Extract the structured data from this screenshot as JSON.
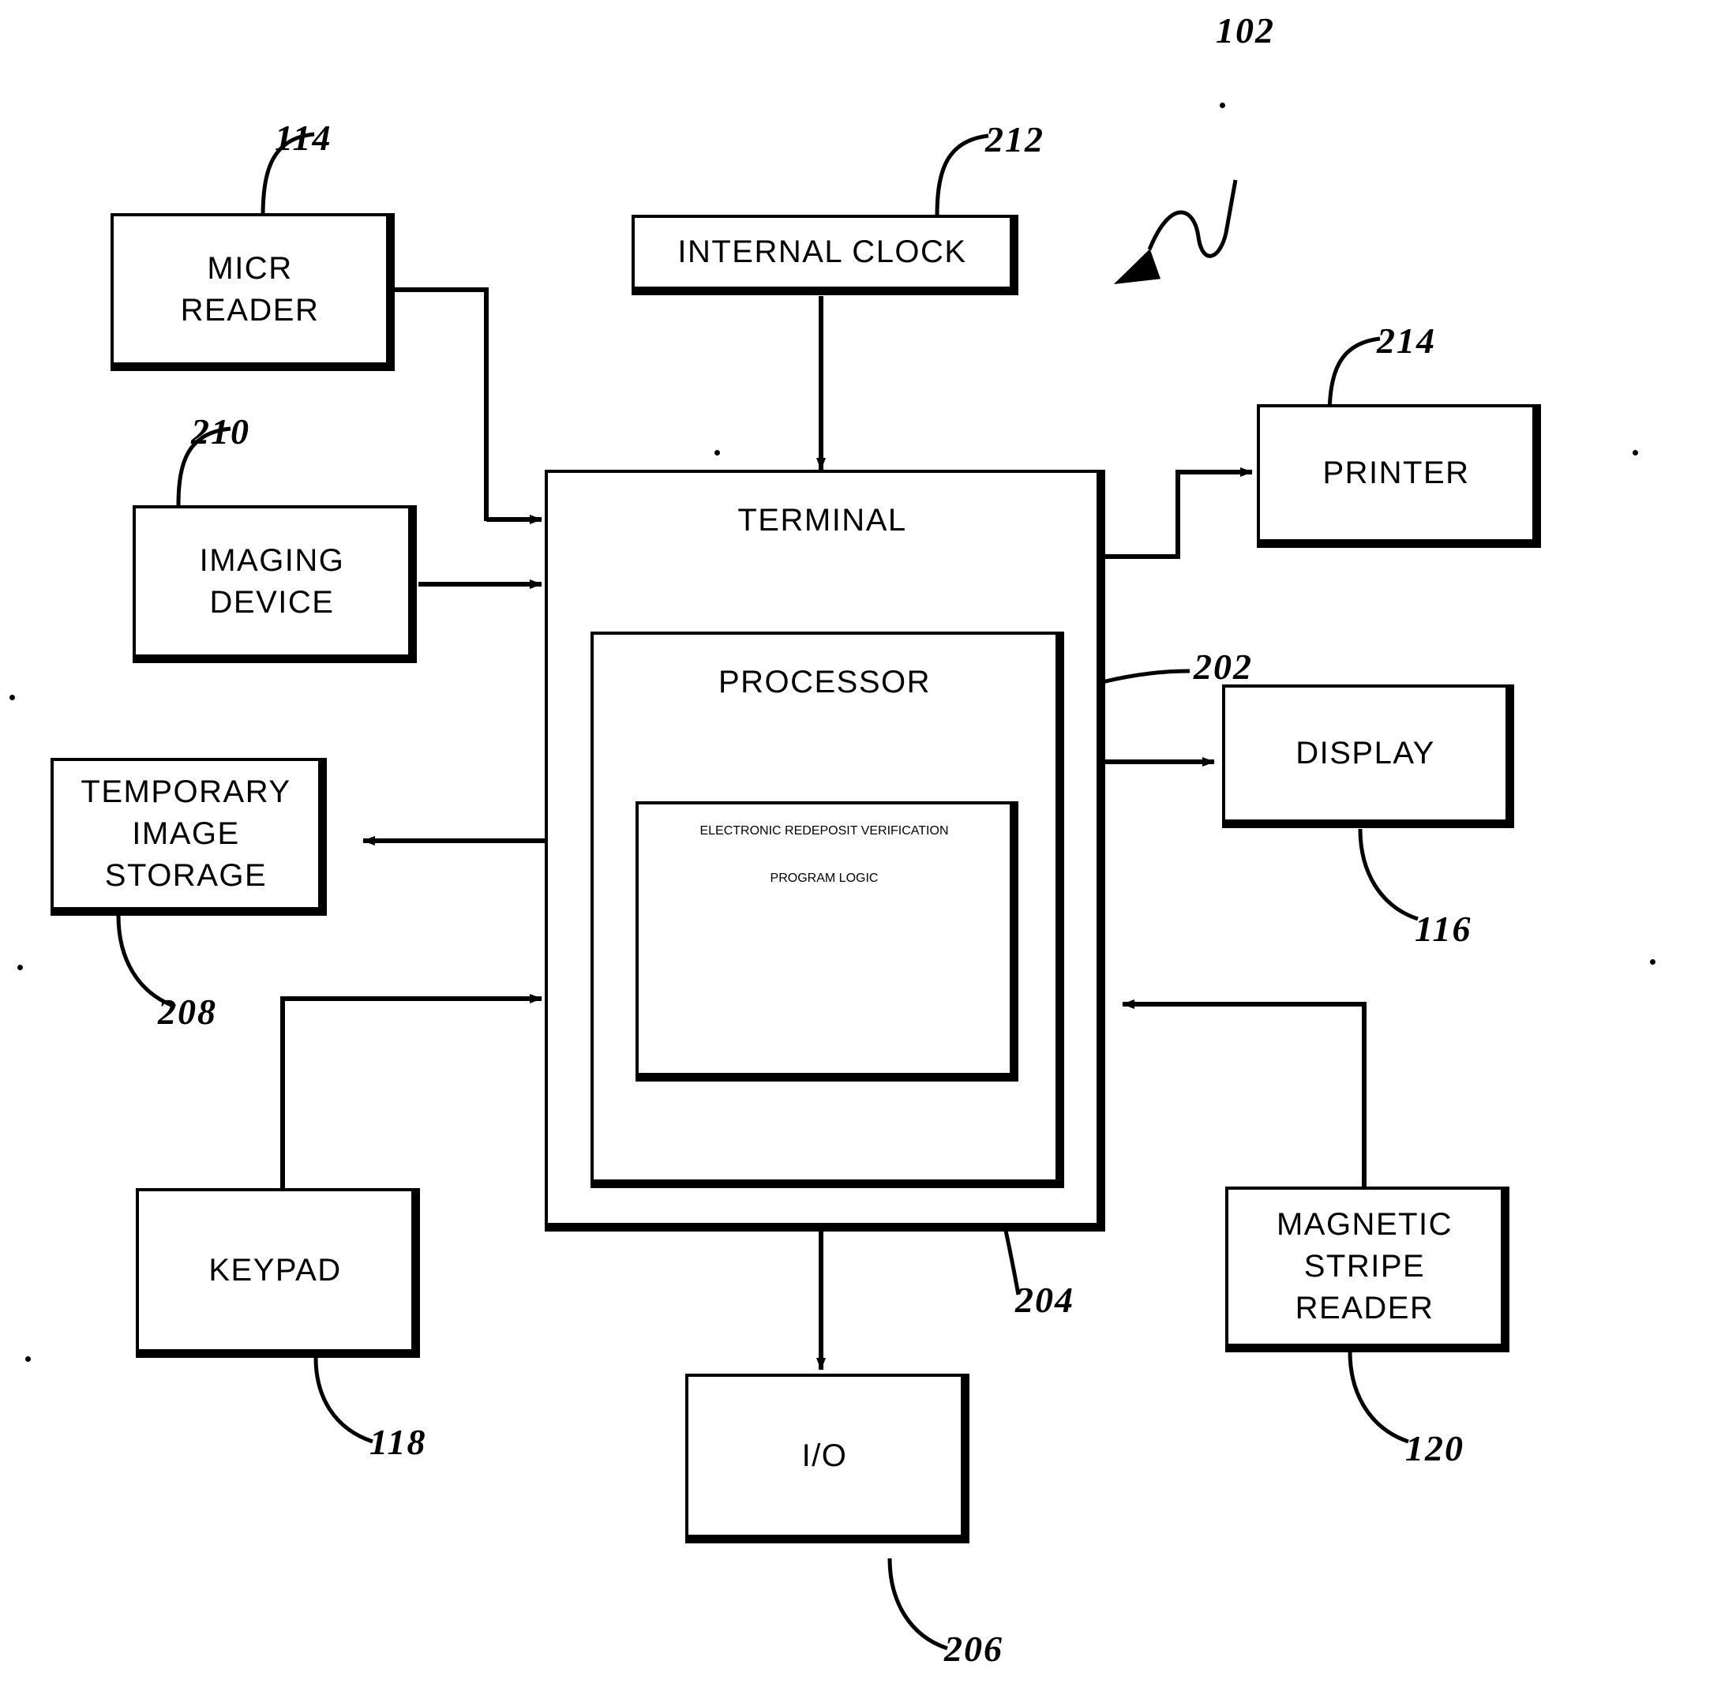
{
  "figure": {
    "type": "patent-block-diagram",
    "system_ref": "102",
    "background_color": "#ffffff",
    "line_color": "#000000"
  },
  "blocks": {
    "micr_reader": {
      "label": "MICR\nREADER",
      "ref": "114"
    },
    "imaging_device": {
      "label": "IMAGING\nDEVICE",
      "ref": "210"
    },
    "temp_storage": {
      "label": "TEMPORARY\nIMAGE\nSTORAGE",
      "ref": "208"
    },
    "keypad": {
      "label": "KEYPAD",
      "ref": "118"
    },
    "internal_clock": {
      "label": "INTERNAL  CLOCK",
      "ref": "212"
    },
    "terminal": {
      "label": "TERMINAL",
      "ref": "202"
    },
    "processor": {
      "label": "PROCESSOR",
      "ref": ""
    },
    "program_logic": {
      "label": "ELECTRONIC\nREDEPOSIT\nVERIFICATION",
      "label2": "PROGRAM  LOGIC",
      "ref": "204"
    },
    "printer": {
      "label": "PRINTER",
      "ref": "214"
    },
    "display": {
      "label": "DISPLAY",
      "ref": "116"
    },
    "mag_stripe": {
      "label": "MAGNETIC\nSTRIPE\nREADER",
      "ref": "120"
    },
    "io": {
      "label": "I/O",
      "ref": "206"
    }
  },
  "refs": {
    "system": "102",
    "micr_reader": "114",
    "imaging_device": "210",
    "temp_storage": "208",
    "keypad": "118",
    "internal_clock": "212",
    "terminal": "202",
    "program_logic": "204",
    "printer": "214",
    "display": "116",
    "mag_stripe": "120",
    "io": "206"
  }
}
